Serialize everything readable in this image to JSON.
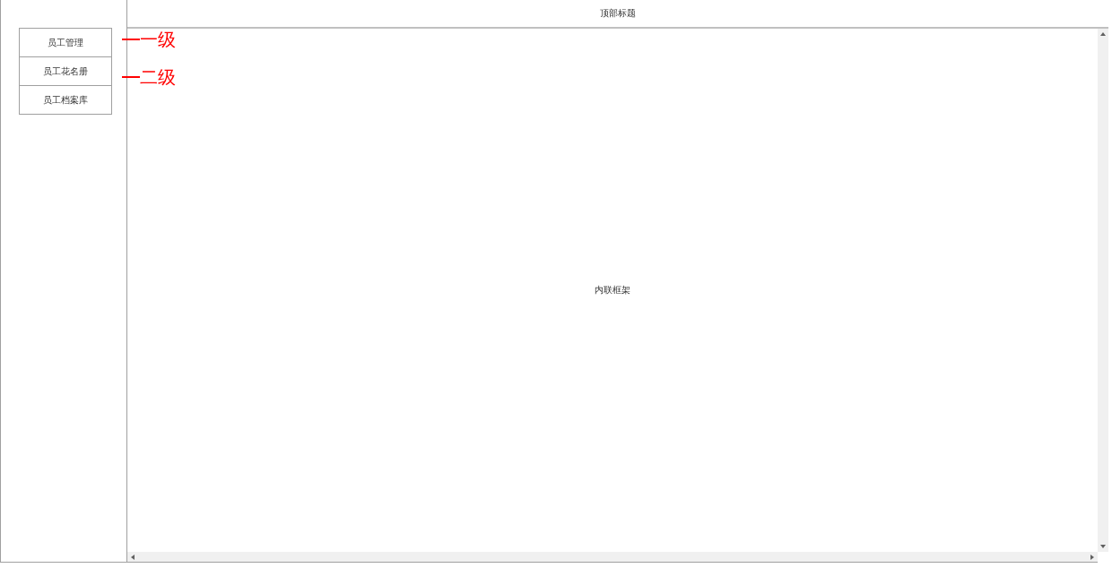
{
  "sidebar": {
    "menu": [
      {
        "label": "员工管理"
      },
      {
        "label": "员工花名册"
      },
      {
        "label": "员工档案库"
      }
    ]
  },
  "header": {
    "title": "顶部标题"
  },
  "content": {
    "label": "内联框架"
  },
  "annotations": [
    {
      "text": "一级"
    },
    {
      "text": "二级"
    }
  ]
}
